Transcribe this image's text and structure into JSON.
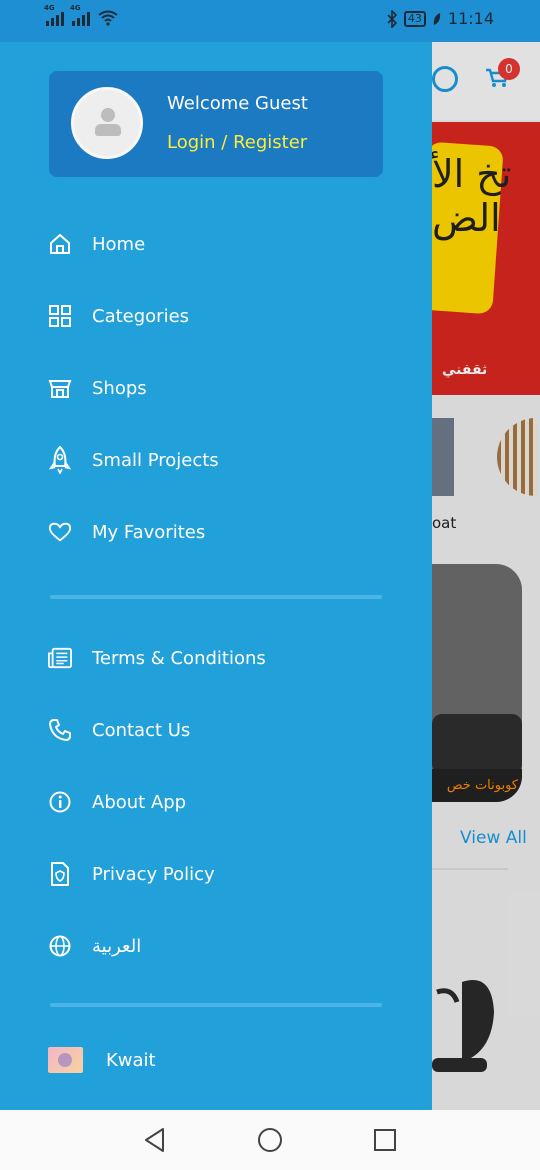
{
  "status_bar": {
    "signal_1": "4G",
    "signal_2": "4G",
    "battery": "43",
    "time": "11:14"
  },
  "background_app": {
    "cart_count": "0",
    "banner_text": "تخ الأ الض",
    "banner_brand": "ثقفني",
    "thumb_label": "oat",
    "promo_text": "كوبونات خص",
    "view_all": "View All"
  },
  "drawer": {
    "profile": {
      "welcome": "Welcome Guest",
      "login": "Login / Register"
    },
    "main_items": [
      {
        "label": "Home",
        "icon": "home-icon"
      },
      {
        "label": "Categories",
        "icon": "grid-icon"
      },
      {
        "label": "Shops",
        "icon": "store-icon"
      },
      {
        "label": "Small Projects",
        "icon": "rocket-icon"
      },
      {
        "label": "My Favorites",
        "icon": "heart-icon"
      }
    ],
    "info_items": [
      {
        "label": "Terms & Conditions",
        "icon": "document-icon"
      },
      {
        "label": "Contact Us",
        "icon": "phone-icon"
      },
      {
        "label": "About App",
        "icon": "info-icon"
      },
      {
        "label": "Privacy Policy",
        "icon": "shield-document-icon"
      },
      {
        "label": "العربية",
        "icon": "globe-icon"
      }
    ],
    "country": {
      "label": "Kwait",
      "icon": "flag-icon"
    }
  },
  "colors": {
    "drawer_bg": "#22a0da",
    "profile_bg": "#1b7ac2",
    "login_color": "#ffeb3b",
    "accent": "#1b9ae0"
  }
}
